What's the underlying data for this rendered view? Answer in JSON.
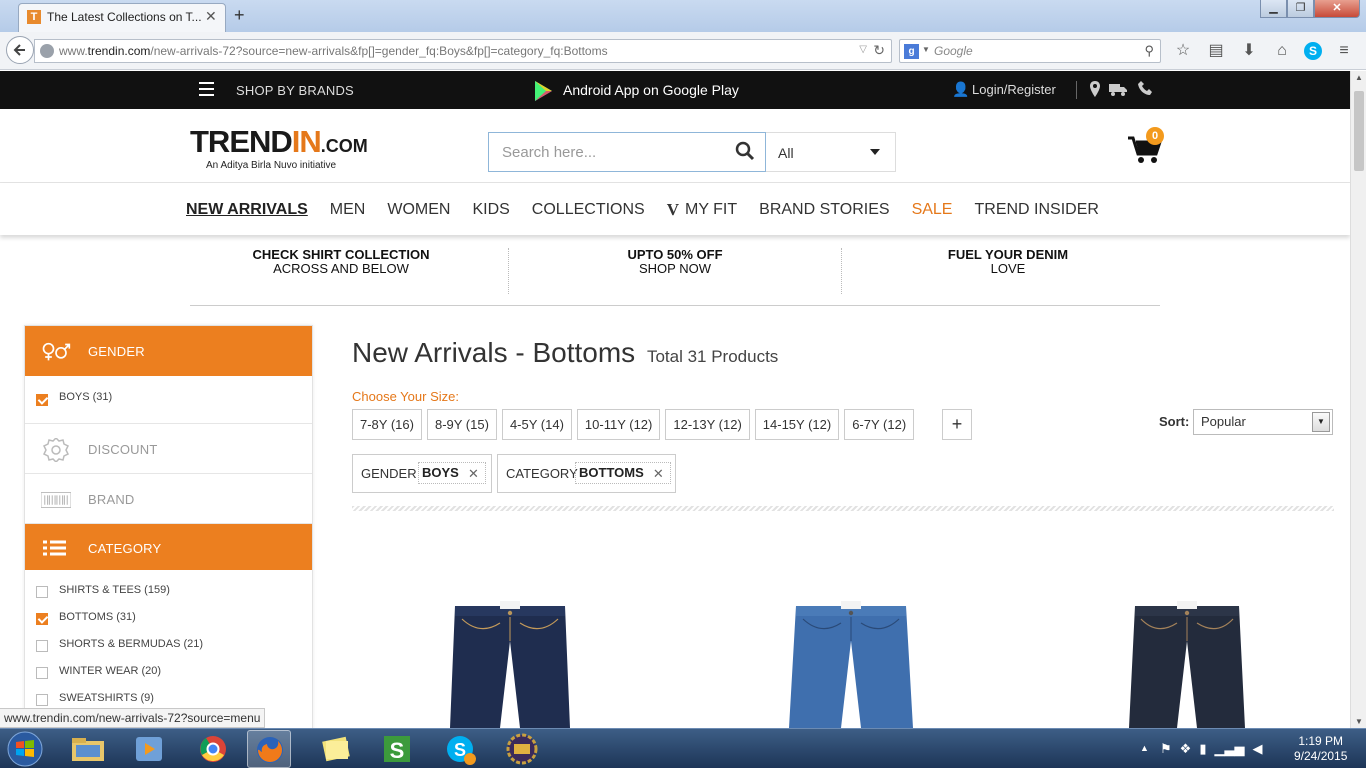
{
  "browser": {
    "tab_title": "The Latest Collections on T...",
    "tab_favicon": "T",
    "new_tab": "+",
    "url_prefix": "www.",
    "url_domain": "trendin.com",
    "url_path": "/new-arrivals-72?source=new-arrivals&fp[]=gender_fq:Boys&fp[]=category_fq:Bottoms",
    "search_engine_letter": "g",
    "search_placeholder": "Google",
    "status_url": "www.trendin.com/new-arrivals-72?source=menu"
  },
  "topbar": {
    "shop_by_brands": "SHOP BY BRANDS",
    "android_app": "Android App on Google Play",
    "login": "Login/Register"
  },
  "header": {
    "logo_main": "TREND",
    "logo_accent": "IN",
    "logo_suffix": ".COM",
    "logo_tagline": "An Aditya Birla Nuvo initiative",
    "search_placeholder": "Search here...",
    "category_select": "All",
    "cart_count": "0"
  },
  "mainnav": [
    {
      "label": "NEW ARRIVALS",
      "active": true
    },
    {
      "label": "MEN"
    },
    {
      "label": "WOMEN"
    },
    {
      "label": "KIDS"
    },
    {
      "label": "COLLECTIONS"
    },
    {
      "label": "MY FIT"
    },
    {
      "label": "BRAND STORIES"
    },
    {
      "label": "SALE"
    },
    {
      "label": "TREND INSIDER"
    }
  ],
  "promos": [
    {
      "title": "CHECK SHIRT COLLECTION",
      "sub": "ACROSS AND BELOW"
    },
    {
      "title": "UPTO 50% OFF",
      "sub": "SHOP NOW"
    },
    {
      "title": "FUEL YOUR DENIM",
      "sub": "LOVE"
    }
  ],
  "sidebar": {
    "gender": {
      "label": "GENDER",
      "options": [
        {
          "label": "BOYS (31)",
          "checked": true
        }
      ]
    },
    "discount": {
      "label": "DISCOUNT"
    },
    "brand": {
      "label": "BRAND"
    },
    "category": {
      "label": "CATEGORY",
      "options": [
        {
          "label": "SHIRTS & TEES (159)",
          "checked": false
        },
        {
          "label": "BOTTOMS (31)",
          "checked": true
        },
        {
          "label": "SHORTS & BERMUDAS (21)",
          "checked": false
        },
        {
          "label": "WINTER WEAR (20)",
          "checked": false
        },
        {
          "label": "SWEATSHIRTS (9)",
          "checked": false
        }
      ]
    }
  },
  "content": {
    "title": "New Arrivals - Bottoms",
    "total": "Total 31 Products",
    "size_label": "Choose Your Size:",
    "sizes": [
      "7-8Y (16)",
      "8-9Y (15)",
      "4-5Y (14)",
      "10-11Y (12)",
      "12-13Y (12)",
      "14-15Y (12)",
      "6-7Y (12)"
    ],
    "more_sizes": "+",
    "sort_label": "Sort:",
    "sort_value": "Popular",
    "filters": [
      {
        "key": "GENDER",
        "value": "BOYS"
      },
      {
        "key": "CATEGORY",
        "value": "BOTTOMS"
      }
    ]
  },
  "taskbar": {
    "time": "1:19 PM",
    "date": "9/24/2015"
  },
  "colors": {
    "accent": "#ec7f1f",
    "topbar_bg": "#111111",
    "denim_dark": "#1f2d4f",
    "denim_mid": "#3f6fae",
    "denim_black": "#232b3c"
  }
}
